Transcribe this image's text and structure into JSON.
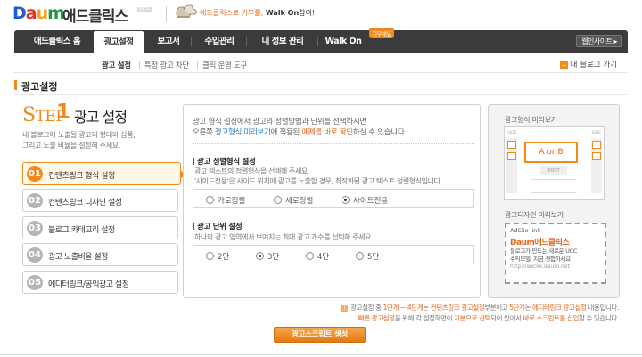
{
  "header": {
    "logo_text_1": "D",
    "logo_text_2": "a",
    "logo_text_3": "u",
    "logo_text_4": "m",
    "app_name": "애드클릭스",
    "beta": "BETA",
    "walkon_banner_1": "애드클릭스로 기부를, ",
    "walkon_banner_2": "Walk On",
    "walkon_banner_3": "참여!"
  },
  "nav": {
    "items": [
      {
        "label": "애드클릭스 홈"
      },
      {
        "label": "광고설정"
      },
      {
        "label": "보고서"
      },
      {
        "label": "수입관리"
      },
      {
        "label": "내 정보 관리"
      },
      {
        "label": "Walk On"
      }
    ],
    "walkon_badge": "기부채널",
    "webin_button": "웹인사이트 ▸"
  },
  "subnav": {
    "items": [
      "광고 설정",
      "특정 광고 차단",
      "클릭 운영 도구"
    ],
    "myblog": "내 블로그 가기"
  },
  "page": {
    "title": "광고설정"
  },
  "step": {
    "label_s": "S",
    "label_rest": "TEP",
    "num": "1",
    "title": "광고 설정",
    "desc_1": "내 블로그에 노출될 광고의 형태와 심품,",
    "desc_2": "그리고 노출 비율을 설정해 주세요."
  },
  "menu": [
    {
      "num": "01",
      "label": "컨텐츠링크 형식 설정"
    },
    {
      "num": "02",
      "label": "컨텐츠링크 디자인 설정"
    },
    {
      "num": "03",
      "label": "블로그 카테고리 설정"
    },
    {
      "num": "04",
      "label": "광고 노출비율 설정"
    },
    {
      "num": "05",
      "label": "에디터링크/공익광고 설정"
    }
  ],
  "main": {
    "intro_1": "광고 형식 설정에서 광고의 정렬방법과 단위를 선택하시면",
    "intro_2a": "오른쪽 ",
    "intro_2b": "광고형식 미리보기",
    "intro_2c": "에 적용된 ",
    "intro_2d": "예제를 바로 확인",
    "intro_2e": "하실 수 있습니다.",
    "sort": {
      "title": "광고 정렬형식 설정",
      "desc_1": "광고 텍스트의 정렬형식을 선택해 주세요.",
      "desc_2": "'사이드전용'은 사이드 위치에 광고를 노출할 경우, 최적화된 광고 텍스트 정렬형식입니다.",
      "options": [
        "가로정렬",
        "세로정렬",
        "사이드전용"
      ],
      "selected": "사이드전용"
    },
    "unit": {
      "title": "광고 단위 설정",
      "desc": "하나의 광고 영역에서 보여지는 최대 광고 개수를 선택해 주세요.",
      "options": [
        "2단",
        "3단",
        "4단",
        "5단"
      ],
      "selected": "3단"
    }
  },
  "preview": {
    "format_title": "광고형식 미리보기",
    "side_tag": "SIDE",
    "aorb": "A or B",
    "post": "POST",
    "design_title": "광고디자인 미리보기",
    "adclix_header": "AdClix link",
    "adclix_brand": "Daum애드클릭스",
    "adclix_line1": "블로그가 만드는 새로운 UCC",
    "adclix_line2": "수익모델, 지금 경험하세요",
    "adclix_url": "http://adclix.daum.net"
  },
  "notice": {
    "l1a": "광고설정 중 ",
    "l1b": "1단계 ~ 4단계",
    "l1c": "는 ",
    "l1d": "컨텐츠링크 광고설정",
    "l1e": "부분이고 ",
    "l1f": "5단계",
    "l1g": "는 ",
    "l1h": "에디터링크 광고설정",
    "l1i": " 내용입니다.",
    "l2a": "빠른 광고설정",
    "l2b": "을 위해 각 설정화면이 ",
    "l2c": "기본으로 선택",
    "l2d": "되어 있어서 ",
    "l2e": "바로 스크립트를 삽입",
    "l2f": "할 수 있습니다."
  },
  "generate_button": "광고스크립트 생성",
  "colors": {
    "accent": "#f08a1c",
    "nav_bg": "#3b3b3b",
    "link_blue": "#2a7fc9"
  }
}
